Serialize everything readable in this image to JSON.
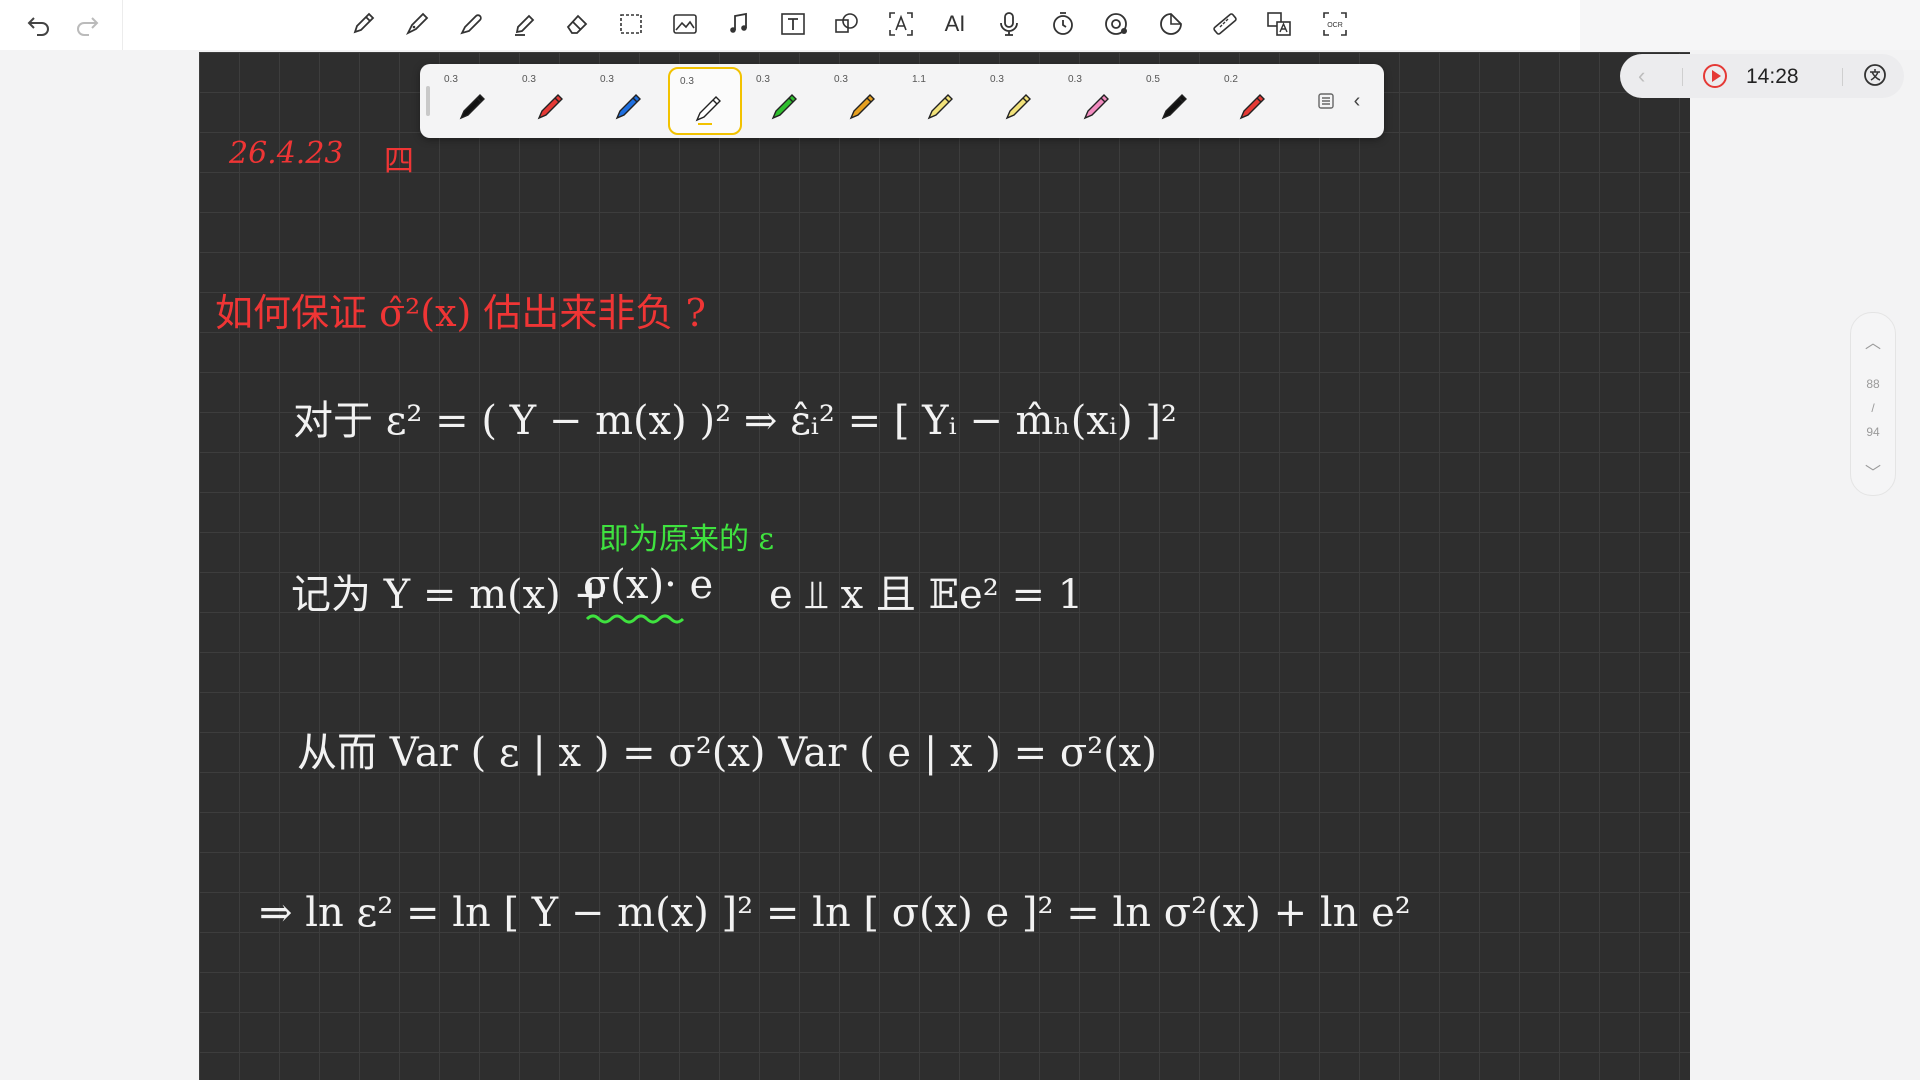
{
  "toolbar": {
    "undo": "undo-icon",
    "redo": "redo-icon",
    "tools": [
      "pencil",
      "fountain-pen",
      "ballpoint-pen",
      "highlighter",
      "eraser",
      "lasso",
      "image",
      "music",
      "text-box",
      "shape",
      "ocr-text",
      "ai",
      "microphone",
      "timer",
      "recorder",
      "sticker",
      "ruler",
      "translate",
      "ocr-scan"
    ],
    "ai_label": "AI",
    "ocr_label": "OCR"
  },
  "palette": {
    "pens": [
      {
        "size": "0.3",
        "color": "#111111"
      },
      {
        "size": "0.3",
        "color": "#e53935"
      },
      {
        "size": "0.3",
        "color": "#1e6fe0"
      },
      {
        "size": "0.3",
        "color": "#ffffff",
        "selected": true
      },
      {
        "size": "0.3",
        "color": "#2fbf2f"
      },
      {
        "size": "0.3",
        "color": "#e6a020"
      },
      {
        "size": "1.1",
        "color": "#f2e27a"
      },
      {
        "size": "0.3",
        "color": "#f2e27a"
      },
      {
        "size": "0.3",
        "color": "#f28cc0"
      },
      {
        "size": "0.5",
        "color": "#111111"
      },
      {
        "size": "0.2",
        "color": "#e53935"
      }
    ]
  },
  "recording": {
    "time": "14:28"
  },
  "pager": {
    "current": "88",
    "separator": "/",
    "total": "94"
  },
  "notes": {
    "date": "26.4.23",
    "weekday": "四",
    "question": "如何保证 σ̂²(x) 估出来非负 ?",
    "line1": "对于 ε² = ( Y − m(x) )²   ⇒   ε̂ᵢ² = [ Yᵢ − m̂ₕ(xᵢ) ]²",
    "green_note": "即为原来的 ε",
    "line2_a": "记为 Y = m(x) +",
    "line2_b": "σ(x)· e",
    "line2_c": "e ⫫ x   且   𝔼e² = 1",
    "line3": "从而 Var ( ε | x ) = σ²(x) Var ( e | x ) = σ²(x)",
    "line4": "⇒  ln ε² = ln [ Y − m(x) ]² = ln [ σ(x) e ]² = ln σ²(x) + ln e²"
  }
}
